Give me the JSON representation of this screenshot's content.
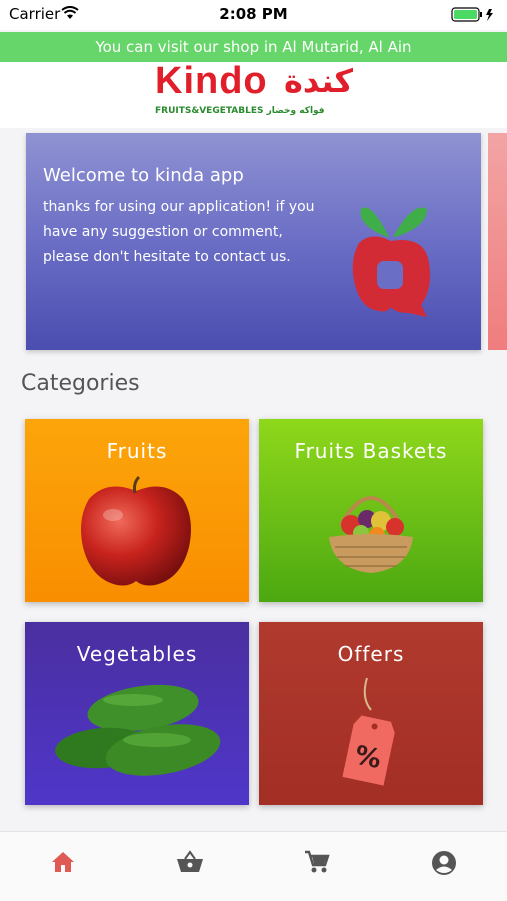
{
  "status_bar": {
    "carrier": "Carrier",
    "time": "2:08 PM"
  },
  "banner": {
    "text": "You can visit our shop in Al Mutarid, Al Ain"
  },
  "logo": {
    "name_en": "Kindo",
    "name_ar": "كندة",
    "tagline": "FRUITS&VEGETABLES فواكه وخضار"
  },
  "welcome": {
    "title": "Welcome to kinda app",
    "body": "thanks for using our application! if you have any suggestion or comment, please don't hesitate to contact us."
  },
  "categories": {
    "title": "Categories",
    "items": [
      {
        "label": "Fruits",
        "icon": "apple-image"
      },
      {
        "label": "Fruits Baskets",
        "icon": "fruit-basket-image"
      },
      {
        "label": "Vegetables",
        "icon": "cucumber-image"
      },
      {
        "label": "Offers",
        "icon": "percent-tag-image"
      }
    ]
  },
  "tab_bar": {
    "items": [
      {
        "icon": "home-icon",
        "active": true
      },
      {
        "icon": "basket-icon",
        "active": false
      },
      {
        "icon": "cart-icon",
        "active": false
      },
      {
        "icon": "account-icon",
        "active": false
      }
    ]
  },
  "colors": {
    "banner": "#66d66a",
    "brand_red": "#e11f2b",
    "tab_active": "#e05a55",
    "tab_inactive": "#555555"
  }
}
